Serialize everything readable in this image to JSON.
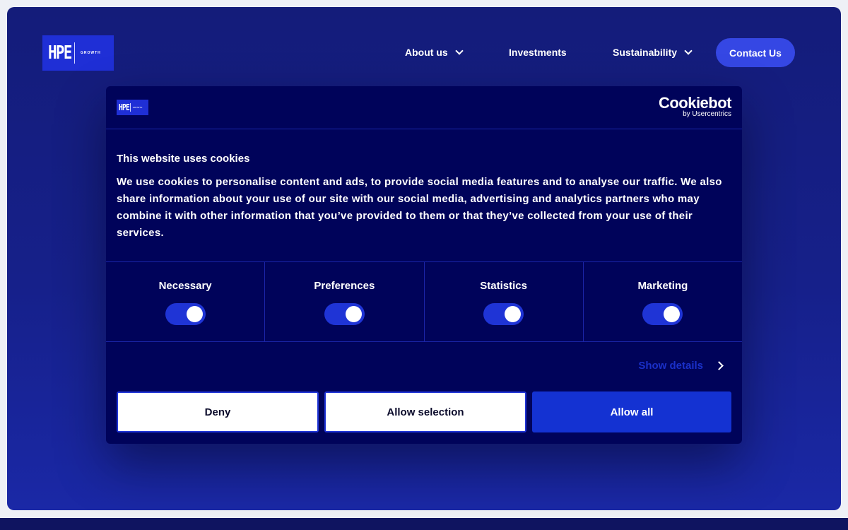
{
  "header": {
    "logo_text": "HPE",
    "logo_sub": "GROWTH",
    "nav": [
      {
        "label": "About us",
        "has_dropdown": true
      },
      {
        "label": "Investments",
        "has_dropdown": false
      },
      {
        "label": "Sustainability",
        "has_dropdown": true
      }
    ],
    "contact_label": "Contact Us"
  },
  "dialog": {
    "logo_text": "HPE",
    "logo_sub": "GROWTH",
    "brand": "Cookiebot",
    "brand_sub": "by Usercentrics",
    "title": "This website uses cookies",
    "text": "We use cookies to personalise content and ads, to provide social media features and to analyse our traffic. We also share information about your use of our site with our social media, advertising and analytics partners who may combine it with other information that you’ve provided to them or that they’ve collected from your use of their services.",
    "toggles": [
      {
        "label": "Necessary",
        "on": true
      },
      {
        "label": "Preferences",
        "on": true
      },
      {
        "label": "Statistics",
        "on": true
      },
      {
        "label": "Marketing",
        "on": true
      }
    ],
    "show_details": "Show details",
    "buttons": {
      "deny": "Deny",
      "allow_selection": "Allow selection",
      "allow_all": "Allow all"
    }
  },
  "colors": {
    "hero_bg": "#16208a",
    "dialog_bg": "#00035a",
    "accent": "#1432d2",
    "logo_bg": "#1f2fd6"
  }
}
